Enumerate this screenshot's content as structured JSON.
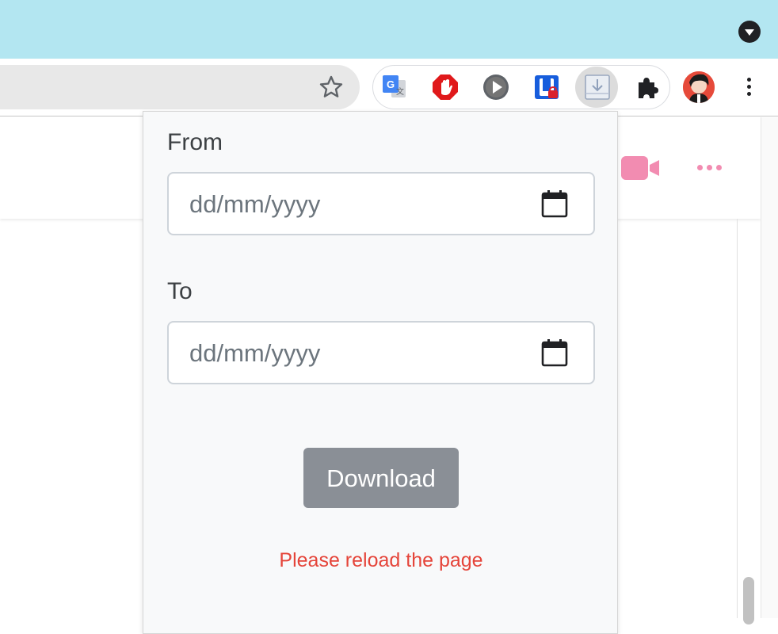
{
  "browser": {
    "titlebar_color": "#b3e6f1",
    "tab_menu_icon": "chevron-down-circle-icon",
    "bookmark_icon": "star-outline-icon",
    "extensions": [
      {
        "name": "google-translate-icon"
      },
      {
        "name": "adblock-hand-icon"
      },
      {
        "name": "play-circle-icon"
      },
      {
        "name": "bitwarden-shield-icon"
      },
      {
        "name": "download-tray-icon"
      },
      {
        "name": "puzzle-extensions-icon"
      }
    ],
    "profile_icon": "avatar",
    "menu_icon": "kebab-menu-icon"
  },
  "page": {
    "accent_color": "#f28cb1",
    "icons": [
      "video-camera-icon",
      "more-horizontal-icon"
    ]
  },
  "popup": {
    "from_label": "From",
    "from_placeholder": "dd/mm/yyyy",
    "to_label": "To",
    "to_placeholder": "dd/mm/yyyy",
    "download_label": "Download",
    "error_message": "Please reload the page",
    "error_color": "#e5453a",
    "button_color": "#8a8f96"
  }
}
